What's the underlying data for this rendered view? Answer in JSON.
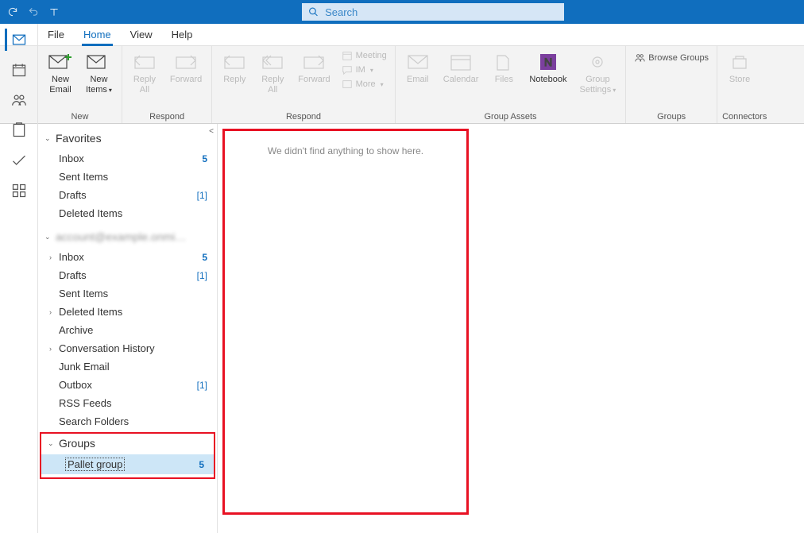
{
  "search": {
    "placeholder": "Search"
  },
  "tabs": {
    "file": "File",
    "home": "Home",
    "view": "View",
    "help": "Help"
  },
  "ribbon": {
    "new": {
      "caption": "New",
      "new_email": "New\nEmail",
      "new_items": "New\nItems"
    },
    "respond1": {
      "caption": "Respond",
      "reply": "Reply",
      "forward": "Forward",
      "reply_all": "Reply\nAll"
    },
    "respond2": {
      "caption": "Respond",
      "reply": "Reply",
      "reply_all": "Reply\nAll",
      "forward": "Forward",
      "meeting": "Meeting",
      "im": "IM",
      "more": "More"
    },
    "assets": {
      "caption": "Group Assets",
      "email": "Email",
      "calendar": "Calendar",
      "files": "Files",
      "notebook": "Notebook",
      "settings": "Group\nSettings"
    },
    "groups": {
      "caption": "Groups",
      "browse": "Browse Groups"
    },
    "connectors": {
      "caption": "Connectors",
      "store": "Store"
    }
  },
  "folders": {
    "favorites": {
      "header": "Favorites",
      "items": [
        {
          "name": "Inbox",
          "count": "5"
        },
        {
          "name": "Sent Items"
        },
        {
          "name": "Drafts",
          "count": "[1]"
        },
        {
          "name": "Deleted Items"
        }
      ]
    },
    "account": {
      "items": [
        {
          "name": "Inbox",
          "count": "5",
          "expandable": true
        },
        {
          "name": "Drafts",
          "count": "[1]"
        },
        {
          "name": "Sent Items"
        },
        {
          "name": "Deleted Items",
          "expandable": true
        },
        {
          "name": "Archive"
        },
        {
          "name": "Conversation History",
          "expandable": true
        },
        {
          "name": "Junk Email"
        },
        {
          "name": "Outbox",
          "count": "[1]"
        },
        {
          "name": "RSS Feeds"
        },
        {
          "name": "Search Folders"
        }
      ]
    },
    "groups": {
      "header": "Groups",
      "items": [
        {
          "name": "Pallet group",
          "count": "5",
          "selected": true
        }
      ]
    }
  },
  "content": {
    "empty_msg": "We didn't find anything to show here."
  }
}
